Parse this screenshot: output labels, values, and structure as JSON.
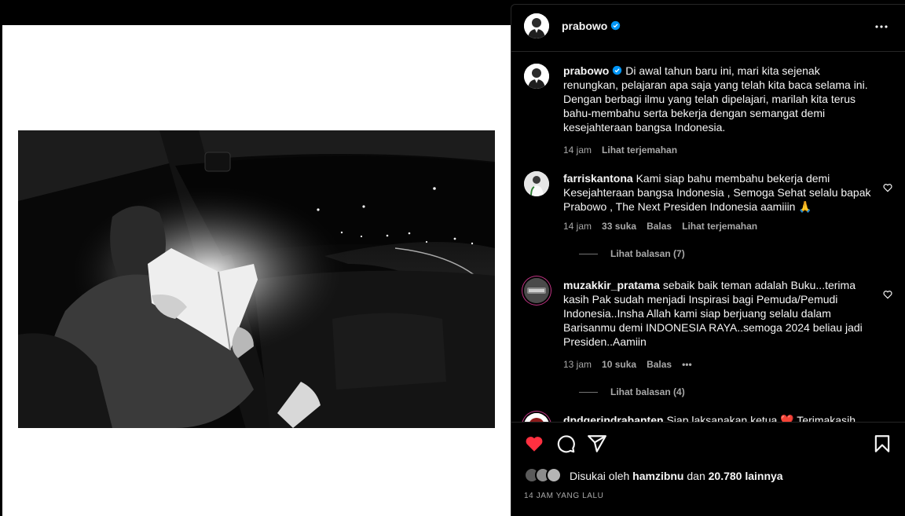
{
  "post": {
    "author": "prabowo",
    "caption": "Di awal tahun baru ini, mari kita sejenak renungkan, pelajaran apa saja yang telah kita baca selama ini. Dengan berbagi ilmu yang telah dipelajari, marilah kita terus bahu-membahu serta bekerja dengan semangat demi kesejahteraan bangsa Indonesia.",
    "time": "14 jam",
    "translate": "Lihat terjemahan"
  },
  "comments": [
    {
      "user": "farriskantona",
      "text": "Kami siap bahu membahu bekerja demi Kesejahteraan bangsa Indonesia , Semoga Sehat selalu bapak Prabowo , The Next Presiden Indonesia aamiiin 🙏",
      "time": "14 jam",
      "likes": "33 suka",
      "reply": "Balas",
      "translate": "Lihat terjemahan",
      "view_replies": "Lihat balasan (7)"
    },
    {
      "user": "muzakkir_pratama",
      "text": "sebaik baik teman adalah Buku...terima kasih Pak sudah menjadi Inspirasi bagi Pemuda/Pemudi Indonesia..Insha Allah kami siap berjuang selalu dalam Barisanmu demi INDONESIA RAYA..semoga 2024 beliau jadi Presiden..Aamiin",
      "time": "13 jam",
      "likes": "10 suka",
      "reply": "Balas",
      "more": "•••",
      "view_replies": "Lihat balasan (4)"
    },
    {
      "user": "dpdgerindrabanten",
      "text": "Siap laksanakan ketua ❤️ Terimakasih"
    }
  ],
  "footer": {
    "liked_prefix": "Disukai oleh",
    "liked_user": "hamzibnu",
    "liked_and": "dan",
    "liked_count": "20.780 lainnya",
    "timestamp": "14 JAM YANG LALU"
  },
  "icons": {
    "header_more": "more-horizontal-icon",
    "like": "heart-filled-icon",
    "comment": "comment-bubble-icon",
    "share": "paper-plane-icon",
    "save": "bookmark-icon",
    "verified": "verified-badge-icon",
    "comment_like": "heart-outline-icon"
  },
  "colors": {
    "background": "#000000",
    "text": "#f5f5f5",
    "muted": "#a8a8a8",
    "like_red": "#ff3040",
    "verified_blue": "#0095f6",
    "divider": "#262626"
  }
}
